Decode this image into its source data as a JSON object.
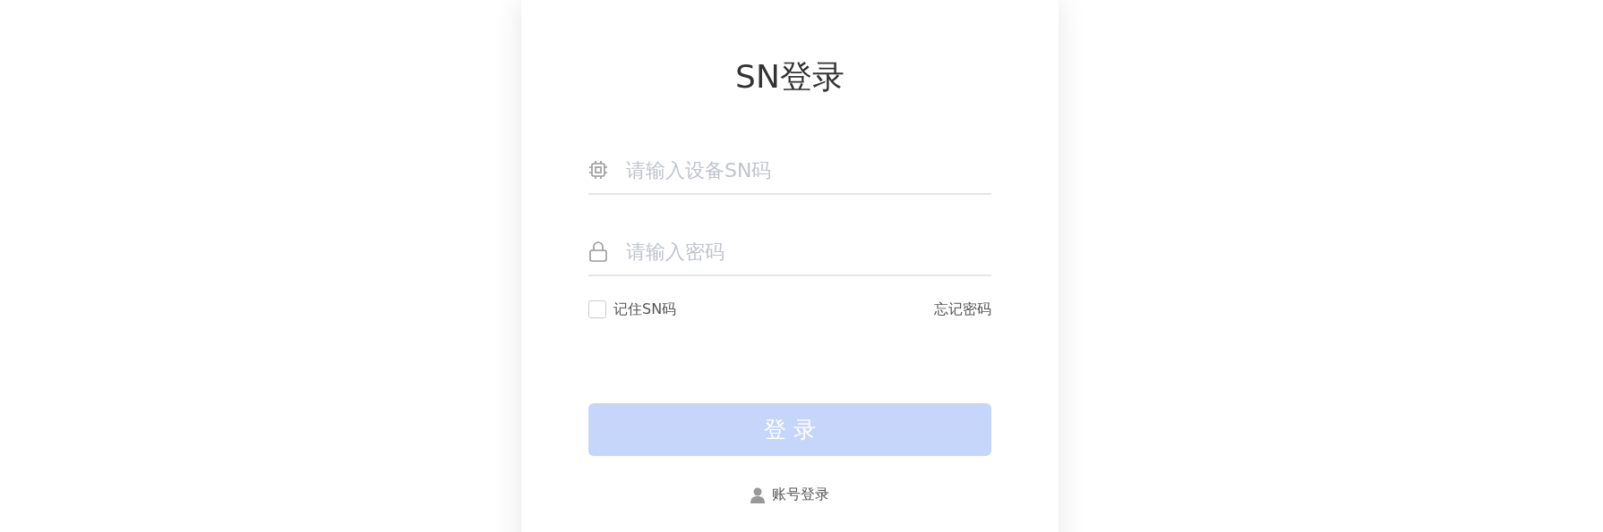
{
  "title": "SN登录",
  "fields": [
    {
      "kind": "chip",
      "placeholder": "请输入设备SN码"
    },
    {
      "kind": "lock",
      "placeholder": "请输入密码"
    }
  ],
  "remember": {
    "label": "记住SN码",
    "checked": false
  },
  "forgot_link": "忘记密码",
  "login_button": {
    "label": "登 录",
    "disabled": true
  },
  "account_login_link": "账号登录"
}
